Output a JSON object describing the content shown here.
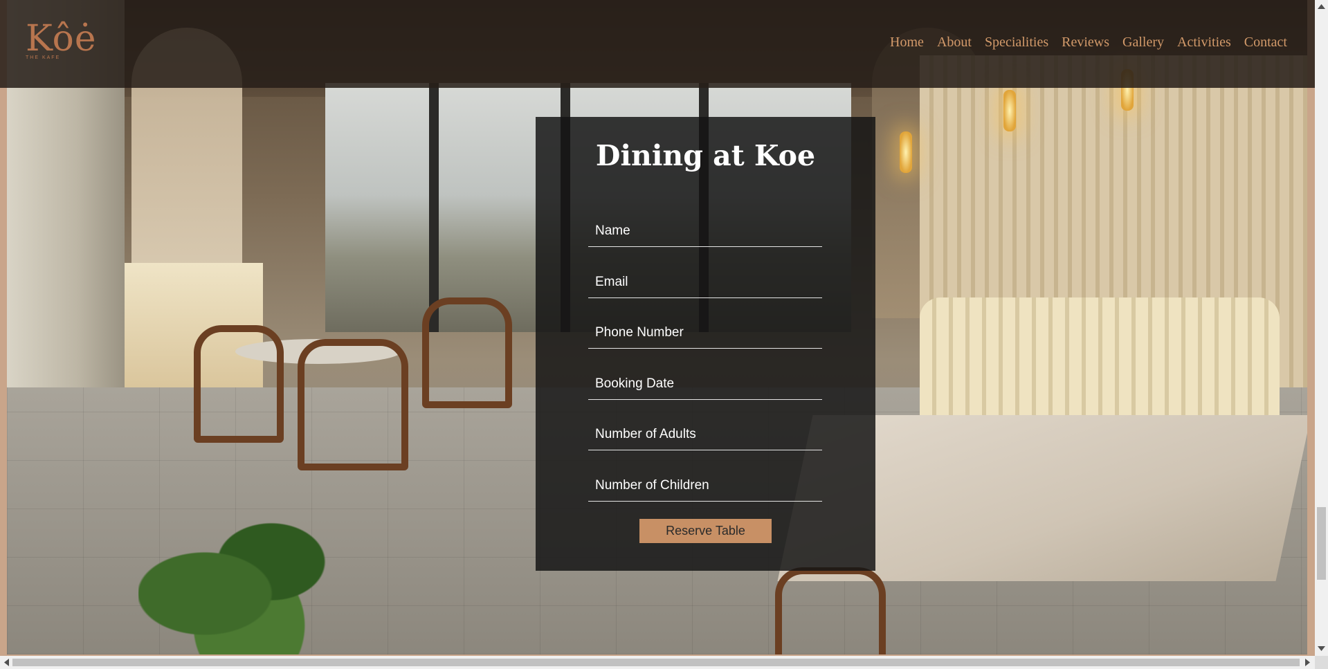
{
  "brand": {
    "logo_text": "Kôė",
    "logo_subtext": "THE KAFE",
    "accent_color": "#d39a6a"
  },
  "nav": {
    "items": [
      {
        "label": "Home"
      },
      {
        "label": "About"
      },
      {
        "label": "Specialities"
      },
      {
        "label": "Reviews"
      },
      {
        "label": "Gallery"
      },
      {
        "label": "Activities"
      },
      {
        "label": "Contact"
      }
    ]
  },
  "reservation": {
    "title": "Dining at Koe",
    "fields": {
      "name": {
        "placeholder": "Name",
        "value": ""
      },
      "email": {
        "placeholder": "Email",
        "value": ""
      },
      "phone": {
        "placeholder": "Phone Number",
        "value": ""
      },
      "date": {
        "placeholder": "Booking Date",
        "value": ""
      },
      "adults": {
        "placeholder": "Number of Adults",
        "value": ""
      },
      "children": {
        "placeholder": "Number of Children",
        "value": ""
      }
    },
    "submit_label": "Reserve Table",
    "button_color": "#c89065"
  },
  "background": {
    "image_alt": "cafe-interior-photo"
  }
}
